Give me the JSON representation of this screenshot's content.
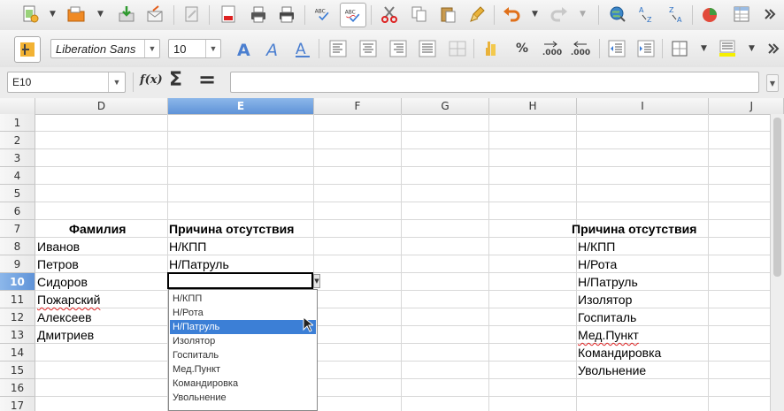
{
  "toolbar2": {
    "font_name": "Liberation Sans",
    "font_size": "10",
    "percent_label": "%",
    "decimal_add_label": ".000",
    "decimal_remove_label": ".000"
  },
  "formula_bar": {
    "name_box": "E10",
    "fx_label": "f(x)",
    "sum_label": "Σ",
    "equals_label": "=",
    "formula_value": ""
  },
  "columns": [
    {
      "label": "D"
    },
    {
      "label": "E",
      "active": true
    },
    {
      "label": "F"
    },
    {
      "label": "G"
    },
    {
      "label": "H"
    },
    {
      "label": "I"
    },
    {
      "label": "J"
    }
  ],
  "rows": [
    "1",
    "2",
    "3",
    "4",
    "5",
    "6",
    "7",
    "8",
    "9",
    "10",
    "11",
    "12",
    "13",
    "14",
    "15",
    "16",
    "17"
  ],
  "active_row": "10",
  "cells": {
    "d7": "Фамилия",
    "e7": "Причина отсутствия",
    "i7": "Причина отсутствия",
    "d8": "Иванов",
    "d9": "Петров",
    "d10": "Сидоров",
    "d11": "Пожарский",
    "d12": "Алексеев",
    "d13": "Дмитриев",
    "e8": "Н/КПП",
    "e9": "Н/Патруль",
    "i8": "Н/КПП",
    "i9": "Н/Рота",
    "i10": "Н/Патруль",
    "i11": "Изолятор",
    "i12": "Госпиталь",
    "i13": "Мед.Пункт",
    "i14": "Командировка",
    "i15": "Увольнение"
  },
  "dropdown": {
    "items": [
      "Н/КПП",
      "Н/Рота",
      "Н/Патруль",
      "Изолятор",
      "Госпиталь",
      "Мед.Пункт",
      "Командировка",
      "Увольнение"
    ],
    "highlighted_index": 2
  },
  "colors": {
    "header_active": "#5f93d8",
    "dropdown_highlight": "#3c7fd6"
  }
}
